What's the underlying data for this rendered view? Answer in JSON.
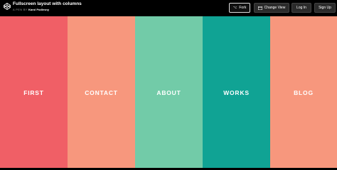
{
  "header": {
    "title": "Fullscreen layout with columns",
    "byline_prefix": "A PEN BY",
    "author": "Karol Podlesny",
    "logo_icon": "codepen-logo-icon"
  },
  "toolbar": {
    "fork_label": "Fork",
    "fork_icon": "fork-icon",
    "change_view_label": "Change View",
    "change_view_icon": "layout-icon",
    "login_label": "Log In",
    "signup_label": "Sign Up"
  },
  "columns": [
    {
      "label": "FIRST",
      "color": "#f05f66"
    },
    {
      "label": "CONTACT",
      "color": "#f7977d"
    },
    {
      "label": "ABOUT",
      "color": "#72cba8"
    },
    {
      "label": "WORKS",
      "color": "#10a394"
    },
    {
      "label": "BLOG",
      "color": "#f7977d"
    }
  ]
}
